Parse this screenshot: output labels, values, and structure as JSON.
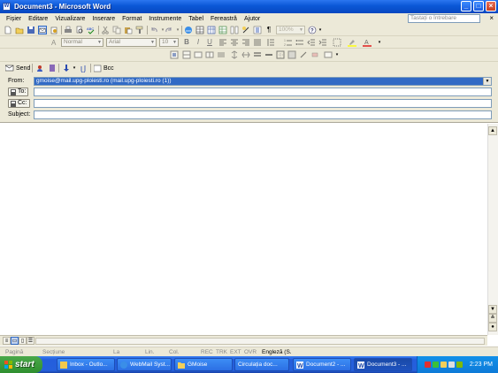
{
  "window": {
    "title": "Document3 - Microsoft Word"
  },
  "menu": {
    "items": [
      "Fișier",
      "Editare",
      "Vizualizare",
      "Inserare",
      "Format",
      "Instrumente",
      "Tabel",
      "Fereastră",
      "Ajutor"
    ],
    "help_placeholder": "Tastați o întrebare"
  },
  "format_toolbar": {
    "style": "Normal",
    "font": "Arial",
    "size": "10",
    "zoom": "100%"
  },
  "email": {
    "send_label": "Send",
    "bcc_label": "Bcc",
    "from_label": "From:",
    "from_value": "gmoise@mail.upg-ploiesti.ro    (mail.upg-ploiesti.ro (1))",
    "to_label": "To:",
    "cc_label": "Cc:",
    "subject_label": "Subject:",
    "to_value": "",
    "cc_value": "",
    "subject_value": ""
  },
  "status": {
    "page": "Pagină",
    "section": "Secțiune",
    "at": "La",
    "line": "Lin.",
    "col": "Col.",
    "rec": "REC",
    "trk": "TRK",
    "ext": "EXT",
    "ovr": "OVR",
    "language": "Engleză (S."
  },
  "taskbar": {
    "start": "start",
    "tasks": [
      "Inbox - Outlo...",
      "WebMail Syst...",
      "GMoise",
      "Circulația doc...",
      "Document2 - ...",
      "Document3 - ..."
    ],
    "clock": "2:23 PM"
  },
  "colors": {
    "title_blue": "#0a57d6",
    "taskbar_blue": "#245edc",
    "start_green": "#3a9a3a",
    "selection": "#316ac5"
  }
}
